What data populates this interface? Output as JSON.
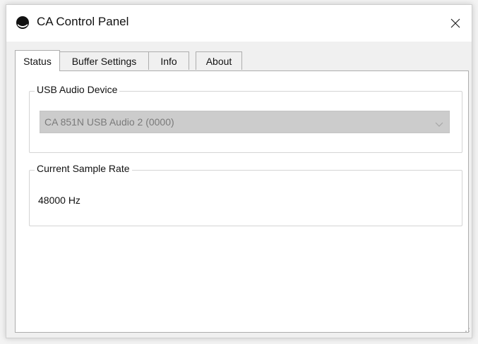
{
  "window": {
    "title": "CA Control Panel",
    "icon": "circle-app-icon",
    "close": "close-icon"
  },
  "tabs": [
    {
      "label": "Status",
      "active": true
    },
    {
      "label": "Buffer Settings",
      "active": false
    },
    {
      "label": "Info",
      "active": false
    },
    {
      "label": "About",
      "active": false
    }
  ],
  "usb_group": {
    "title": "USB Audio Device",
    "device_value": "CA 851N USB Audio 2 (0000)",
    "disabled": true,
    "arrow_icon": "chevron-down-icon"
  },
  "rate_group": {
    "title": "Current Sample Rate",
    "value": "48000 Hz"
  },
  "colors": {
    "titlebar": "#ffffff",
    "window_bg": "#f0f0f0",
    "combo_disabled_bg": "#cccccc",
    "combo_disabled_text": "#7a7a7a"
  }
}
